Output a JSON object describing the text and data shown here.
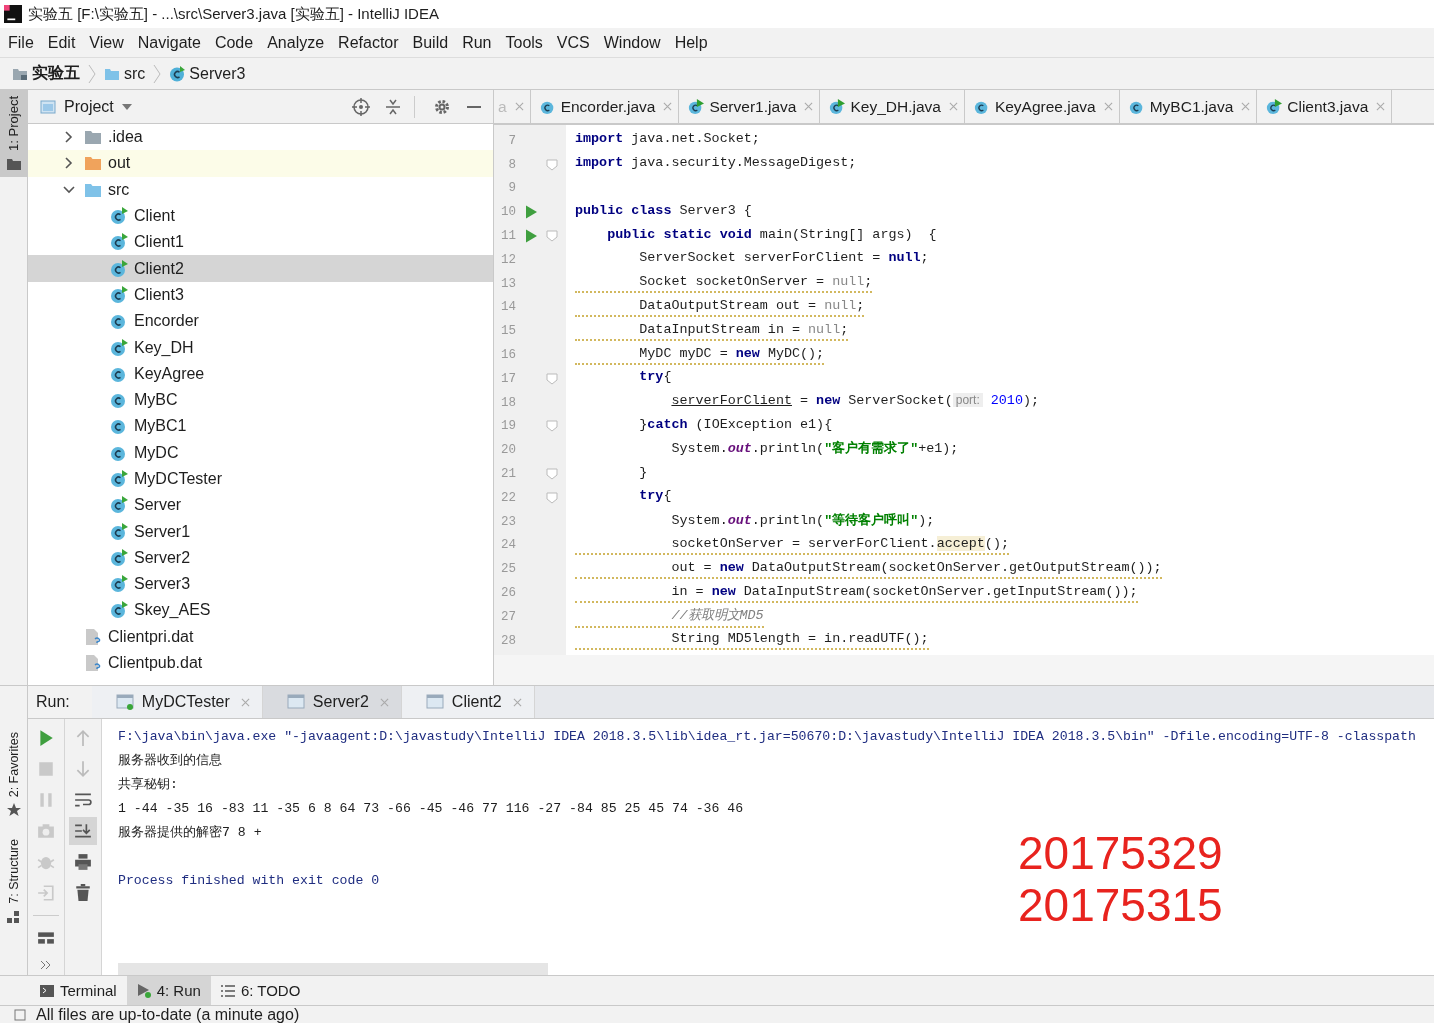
{
  "window": {
    "title": "实验五 [F:\\实验五] - ...\\src\\Server3.java [实验五] - IntelliJ IDEA"
  },
  "menu": [
    "File",
    "Edit",
    "View",
    "Navigate",
    "Code",
    "Analyze",
    "Refactor",
    "Build",
    "Run",
    "Tools",
    "VCS",
    "Window",
    "Help"
  ],
  "breadcrumb": [
    {
      "label": "实验五",
      "kind": "module"
    },
    {
      "label": "src",
      "kind": "folder"
    },
    {
      "label": "Server3",
      "kind": "class"
    }
  ],
  "left_stripe": [
    {
      "label": "1: Project",
      "selected": true
    },
    {
      "label": "2: Favorites",
      "selected": false
    },
    {
      "label": "7: Structure",
      "selected": false
    }
  ],
  "project": {
    "title": "Project",
    "tree": [
      {
        "label": ".idea",
        "kind": "folder",
        "color": "#9aa7b0",
        "expanded": false,
        "selected": false,
        "highlighted": false
      },
      {
        "label": "out",
        "kind": "folder",
        "color": "#f0a35c",
        "expanded": false,
        "selected": false,
        "highlighted": true
      },
      {
        "label": "src",
        "kind": "folder",
        "color": "#7fc2e8",
        "expanded": true,
        "selected": false,
        "highlighted": false,
        "children": [
          {
            "label": "Client",
            "kind": "class",
            "runnable": true,
            "selected": false,
            "highlighted": false
          },
          {
            "label": "Client1",
            "kind": "class",
            "runnable": true,
            "selected": false,
            "highlighted": false
          },
          {
            "label": "Client2",
            "kind": "class",
            "runnable": true,
            "selected": true,
            "highlighted": false
          },
          {
            "label": "Client3",
            "kind": "class",
            "runnable": true,
            "selected": false,
            "highlighted": false
          },
          {
            "label": "Encorder",
            "kind": "class",
            "runnable": false,
            "selected": false,
            "highlighted": false
          },
          {
            "label": "Key_DH",
            "kind": "class",
            "runnable": true,
            "selected": false,
            "highlighted": false
          },
          {
            "label": "KeyAgree",
            "kind": "class",
            "runnable": false,
            "selected": false,
            "highlighted": false
          },
          {
            "label": "MyBC",
            "kind": "class",
            "runnable": false,
            "selected": false,
            "highlighted": false
          },
          {
            "label": "MyBC1",
            "kind": "class",
            "runnable": false,
            "selected": false,
            "highlighted": false
          },
          {
            "label": "MyDC",
            "kind": "class",
            "runnable": false,
            "selected": false,
            "highlighted": false
          },
          {
            "label": "MyDCTester",
            "kind": "class",
            "runnable": true,
            "selected": false,
            "highlighted": false
          },
          {
            "label": "Server",
            "kind": "class",
            "runnable": true,
            "selected": false,
            "highlighted": false
          },
          {
            "label": "Server1",
            "kind": "class",
            "runnable": true,
            "selected": false,
            "highlighted": false
          },
          {
            "label": "Server2",
            "kind": "class",
            "runnable": true,
            "selected": false,
            "highlighted": false
          },
          {
            "label": "Server3",
            "kind": "class",
            "runnable": true,
            "selected": false,
            "highlighted": false
          },
          {
            "label": "Skey_AES",
            "kind": "class",
            "runnable": true,
            "selected": false,
            "highlighted": false
          }
        ]
      },
      {
        "label": "Clientpri.dat",
        "kind": "file",
        "selected": false,
        "highlighted": false
      },
      {
        "label": "Clientpub.dat",
        "kind": "file",
        "selected": false,
        "highlighted": false
      }
    ]
  },
  "editor_tabs": [
    {
      "label": "a",
      "kind": "cut"
    },
    {
      "label": "Encorder.java",
      "kind": "class",
      "runnable": false
    },
    {
      "label": "Server1.java",
      "kind": "class",
      "runnable": true
    },
    {
      "label": "Key_DH.java",
      "kind": "class",
      "runnable": true
    },
    {
      "label": "KeyAgree.java",
      "kind": "class",
      "runnable": false
    },
    {
      "label": "MyBC1.java",
      "kind": "class",
      "runnable": false
    },
    {
      "label": "Client3.java",
      "kind": "class",
      "runnable": true
    }
  ],
  "code": [
    {
      "number": "7",
      "warning": false,
      "tokens": [
        {
          "text": "import",
          "kind": "kw"
        },
        {
          "text": " java.net.Socket;",
          "kind": "plain"
        }
      ]
    },
    {
      "number": "8",
      "fold": true,
      "warning": false,
      "tokens": [
        {
          "text": "import",
          "kind": "kw"
        },
        {
          "text": " java.security.MessageDigest;",
          "kind": "plain"
        }
      ]
    },
    {
      "number": "9"
    },
    {
      "number": "10",
      "run": true,
      "warning": false,
      "tokens": [
        {
          "text": "public class",
          "kind": "kw"
        },
        {
          "text": " Server3 {",
          "kind": "plain"
        }
      ]
    },
    {
      "number": "11",
      "run": true,
      "fold": true,
      "warning": false,
      "tokens": [
        {
          "text": "    public static void",
          "kind": "kw"
        },
        {
          "text": " main(String[] args)  {",
          "kind": "plain"
        }
      ]
    },
    {
      "number": "12",
      "warning": false,
      "tokens": [
        {
          "text": "        ServerSocket serverForClient = ",
          "kind": "plain"
        },
        {
          "text": "null",
          "kind": "kw"
        },
        {
          "text": ";",
          "kind": "plain"
        }
      ]
    },
    {
      "number": "13",
      "warning": true,
      "tokens": [
        {
          "text": "        Socket socketOnServer = ",
          "kind": "plain"
        },
        {
          "text": "null",
          "kind": "dim"
        },
        {
          "text": ";",
          "kind": "plain"
        }
      ]
    },
    {
      "number": "14",
      "warning": true,
      "tokens": [
        {
          "text": "        DataOutputStream out = ",
          "kind": "plain"
        },
        {
          "text": "null",
          "kind": "dim"
        },
        {
          "text": ";",
          "kind": "plain"
        }
      ]
    },
    {
      "number": "15",
      "warning": true,
      "tokens": [
        {
          "text": "        DataInputStream in = ",
          "kind": "plain"
        },
        {
          "text": "null",
          "kind": "dim"
        },
        {
          "text": ";",
          "kind": "plain"
        }
      ]
    },
    {
      "number": "16",
      "warning": true,
      "tokens": [
        {
          "text": "        MyDC myDC = ",
          "kind": "plain"
        },
        {
          "text": "new",
          "kind": "kw"
        },
        {
          "text": " MyDC();",
          "kind": "plain"
        }
      ]
    },
    {
      "number": "17",
      "fold": true,
      "warning": false,
      "tokens": [
        {
          "text": "        try",
          "kind": "kw"
        },
        {
          "text": "{",
          "kind": "plain"
        }
      ]
    },
    {
      "number": "18",
      "warning": false,
      "tokens": [
        {
          "text": "            serverForClient",
          "kind": "ul"
        },
        {
          "text": " = ",
          "kind": "plain"
        },
        {
          "text": "new",
          "kind": "kw"
        },
        {
          "text": " ServerSocket(",
          "kind": "plain"
        },
        {
          "text": "port:",
          "kind": "hint"
        },
        {
          "text": " 2010",
          "kind": "num"
        },
        {
          "text": ");",
          "kind": "plain"
        }
      ]
    },
    {
      "number": "19",
      "fold": true,
      "warning": false,
      "tokens": [
        {
          "text": "        }",
          "kind": "plain"
        },
        {
          "text": "catch",
          "kind": "kw"
        },
        {
          "text": " (IOException e1){",
          "kind": "plain"
        }
      ]
    },
    {
      "number": "20",
      "warning": false,
      "tokens": [
        {
          "text": "            System.",
          "kind": "plain"
        },
        {
          "text": "out",
          "kind": "it"
        },
        {
          "text": ".println(",
          "kind": "plain"
        },
        {
          "text": "\"客户有需求了\"",
          "kind": "str"
        },
        {
          "text": "+e1);",
          "kind": "plain"
        }
      ]
    },
    {
      "number": "21",
      "fold": true,
      "warning": false,
      "tokens": [
        {
          "text": "        }",
          "kind": "plain"
        }
      ]
    },
    {
      "number": "22",
      "fold": true,
      "warning": false,
      "tokens": [
        {
          "text": "        try",
          "kind": "kw"
        },
        {
          "text": "{",
          "kind": "plain"
        }
      ]
    },
    {
      "number": "23",
      "warning": false,
      "tokens": [
        {
          "text": "            System.",
          "kind": "plain"
        },
        {
          "text": "out",
          "kind": "it"
        },
        {
          "text": ".println(",
          "kind": "plain"
        },
        {
          "text": "\"等待客户呼叫\"",
          "kind": "str"
        },
        {
          "text": ");",
          "kind": "plain"
        }
      ]
    },
    {
      "number": "24",
      "warning": true,
      "tokens": [
        {
          "text": "            socketOnServer = serverForClient.",
          "kind": "plain"
        },
        {
          "text": "accept",
          "kind": "hl"
        },
        {
          "text": "();",
          "kind": "plain"
        }
      ]
    },
    {
      "number": "25",
      "warning": true,
      "tokens": [
        {
          "text": "            out = ",
          "kind": "plain"
        },
        {
          "text": "new",
          "kind": "kw"
        },
        {
          "text": " DataOutputStream(socketOnServer.getOutputStream());",
          "kind": "plain"
        }
      ]
    },
    {
      "number": "26",
      "warning": true,
      "tokens": [
        {
          "text": "            in = ",
          "kind": "plain"
        },
        {
          "text": "new",
          "kind": "kw"
        },
        {
          "text": " DataInputStream(socketOnServer.getInputStream());",
          "kind": "plain"
        }
      ]
    },
    {
      "number": "27",
      "warning": true,
      "tokens": [
        {
          "text": "            //获取明文MD5",
          "kind": "comment"
        }
      ]
    },
    {
      "number": "28",
      "warning": true,
      "tokens": [
        {
          "text": "            String MD5length = in.readUTF();",
          "kind": "plain"
        }
      ]
    }
  ],
  "run": {
    "label": "Run:",
    "tabs": [
      {
        "label": "MyDCTester",
        "selected": false
      },
      {
        "label": "Server2",
        "selected": true
      },
      {
        "label": "Client2",
        "selected": false
      }
    ],
    "console": [
      {
        "text": "F:\\java\\bin\\java.exe \"-javaagent:D:\\javastudy\\IntelliJ IDEA 2018.3.5\\lib\\idea_rt.jar=50670:D:\\javastudy\\IntelliJ IDEA 2018.3.5\\bin\" -Dfile.encoding=UTF-8 -classpath",
        "kind": "cmd"
      },
      {
        "text": "服务器收到的信息",
        "kind": "out"
      },
      {
        "text": "共享秘钥:",
        "kind": "out"
      },
      {
        "text": "1 -44 -35 16 -83 11 -35 6 8 64 73 -66 -45 -46 77 116 -27 -84 85 25 45 74 -36 46",
        "kind": "out"
      },
      {
        "text": "服务器提供的解密7 8 +",
        "kind": "out"
      },
      {
        "text": "Process finished with exit code 0",
        "kind": "exit"
      }
    ],
    "overlay_note": [
      "20175329",
      "20175315"
    ]
  },
  "bottom_tabs": [
    {
      "label": "Terminal",
      "kind": "terminal",
      "selected": false
    },
    {
      "label": "4: Run",
      "kind": "run",
      "selected": true
    },
    {
      "label": "6: TODO",
      "kind": "todo",
      "selected": false
    }
  ],
  "status_bar": "All files are up-to-date (a minute ago)"
}
